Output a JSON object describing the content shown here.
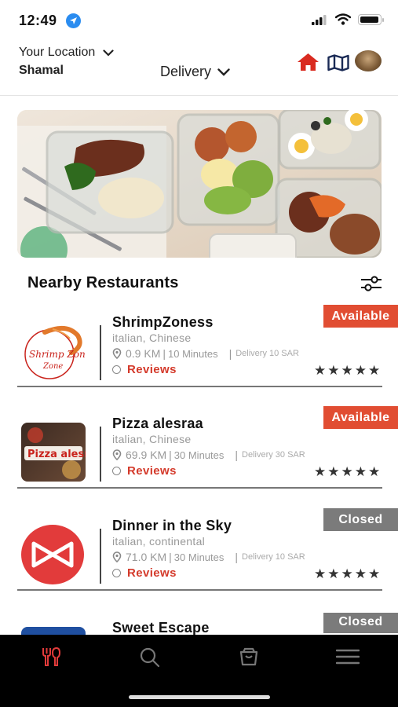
{
  "status_bar": {
    "time": "12:49"
  },
  "header": {
    "location_label": "Your Location",
    "location_value": "Shamal",
    "delivery_mode": "Delivery",
    "icons": [
      "home-icon",
      "map-icon",
      "profile-avatar"
    ]
  },
  "section_title": "Nearby Restaurants",
  "restaurants": [
    {
      "name": "ShrimpZoness",
      "cuisine": "italian, Chinese",
      "distance": "0.9 KM",
      "time": "10 Minutes",
      "delivery": "Delivery 10 SAR",
      "reviews": "Reviews",
      "status": "Available",
      "rating": 5
    },
    {
      "name": "Pizza alesraa",
      "cuisine": "italian, Chinese",
      "distance": "69.9 KM",
      "time": "30 Minutes",
      "delivery": "Delivery 30 SAR",
      "reviews": "Reviews",
      "status": "Available",
      "rating": 5
    },
    {
      "name": "Dinner in the Sky",
      "cuisine": "italian, continental",
      "distance": "71.0 KM",
      "time": "30 Minutes",
      "delivery": "Delivery 10 SAR",
      "reviews": "Reviews",
      "status": "Closed",
      "rating": 5
    },
    {
      "name": "Sweet Escape",
      "status": "Closed"
    }
  ],
  "logo_text": {
    "shrimp": "Shrimp Zone",
    "pizza": "Pizza alesraa"
  },
  "colors": {
    "accent": "#e14d32",
    "closed": "#7b7b7b",
    "review_red": "#d43a2b",
    "tabbar": "#000000"
  },
  "tabs": [
    "restaurants-icon",
    "search-icon",
    "cart-icon",
    "menu-icon"
  ]
}
